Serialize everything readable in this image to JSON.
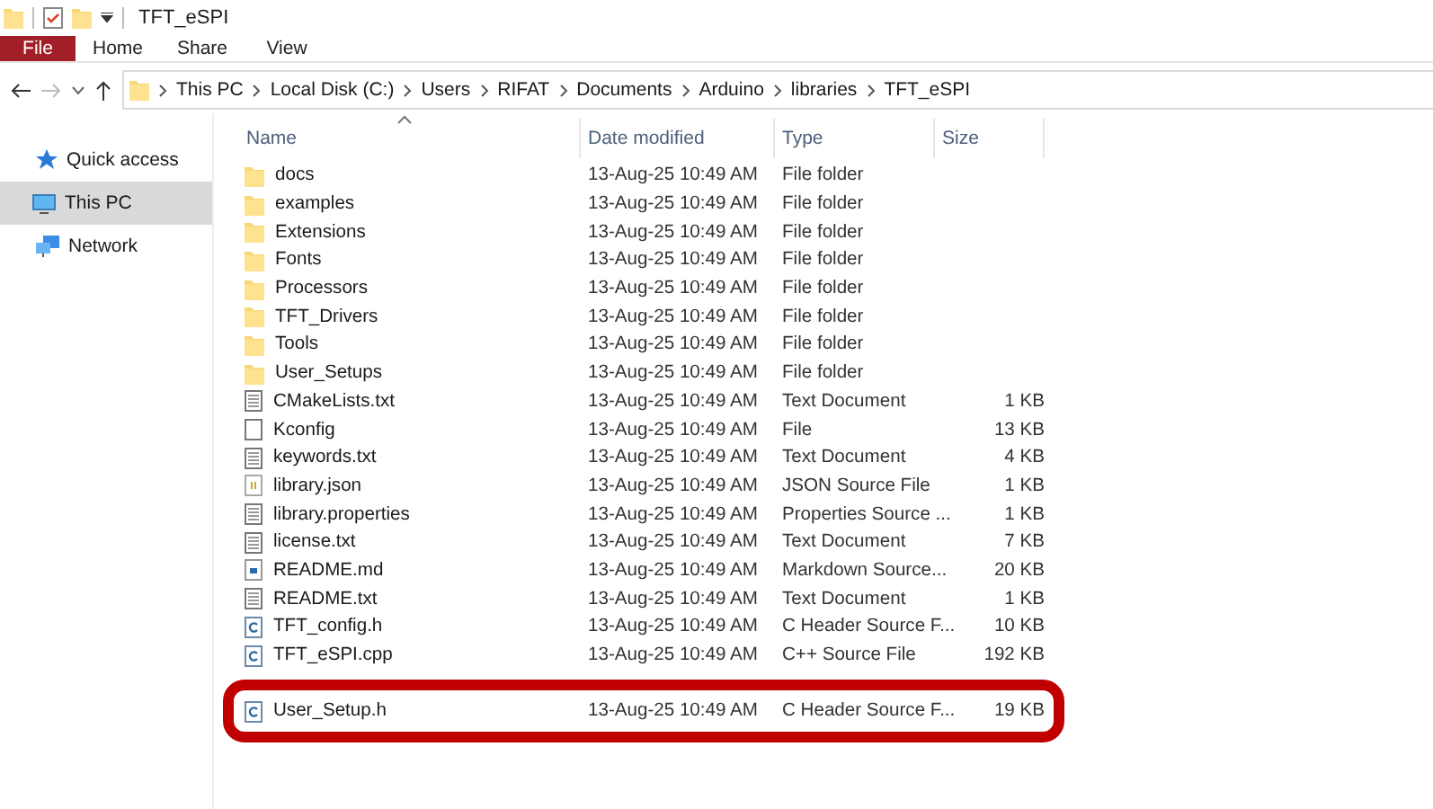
{
  "window": {
    "title": "TFT_eSPI"
  },
  "ribbon_tabs": [
    {
      "label": "File",
      "selected": true
    },
    {
      "label": "Home",
      "selected": false
    },
    {
      "label": "Share",
      "selected": false
    },
    {
      "label": "View",
      "selected": false
    }
  ],
  "navigation": {
    "forward_disabled": true
  },
  "address_bar": {
    "path": [
      "This PC",
      "Local Disk (C:)",
      "Users",
      "RIFAT",
      "Documents",
      "Arduino",
      "libraries",
      "TFT_eSPI"
    ]
  },
  "sidebar": {
    "items": [
      {
        "label": "Quick access",
        "kind": "star",
        "selected": false
      },
      {
        "label": "This PC",
        "kind": "computer",
        "selected": true
      },
      {
        "label": "Network",
        "kind": "network",
        "selected": false
      }
    ]
  },
  "table": {
    "columns": [
      "Name",
      "Date modified",
      "Type",
      "Size"
    ],
    "rows": [
      {
        "name": "docs",
        "date": "13-Aug-25 10:49 AM",
        "type": "File folder",
        "kind": "folder",
        "highlighted": false
      },
      {
        "name": "examples",
        "date": "13-Aug-25 10:49 AM",
        "type": "File folder",
        "kind": "folder",
        "highlighted": false
      },
      {
        "name": "Extensions",
        "date": "13-Aug-25 10:49 AM",
        "type": "File folder",
        "kind": "folder",
        "highlighted": false
      },
      {
        "name": "Fonts",
        "date": "13-Aug-25 10:49 AM",
        "type": "File folder",
        "kind": "folder",
        "highlighted": false
      },
      {
        "name": "Processors",
        "date": "13-Aug-25 10:49 AM",
        "type": "File folder",
        "kind": "folder",
        "highlighted": false
      },
      {
        "name": "TFT_Drivers",
        "date": "13-Aug-25 10:49 AM",
        "type": "File folder",
        "kind": "folder",
        "highlighted": false
      },
      {
        "name": "Tools",
        "date": "13-Aug-25 10:49 AM",
        "type": "File folder",
        "kind": "folder",
        "highlighted": false
      },
      {
        "name": "User_Setups",
        "date": "13-Aug-25 10:49 AM",
        "type": "File folder",
        "kind": "folder",
        "highlighted": false
      },
      {
        "name": "CMakeLists.txt",
        "date": "13-Aug-25 10:49 AM",
        "type": "Text Document",
        "size": "1 KB",
        "kind": "text",
        "highlighted": false
      },
      {
        "name": "Kconfig",
        "date": "13-Aug-25 10:49 AM",
        "type": "File",
        "size": "13 KB",
        "kind": "file",
        "highlighted": false
      },
      {
        "name": "keywords.txt",
        "date": "13-Aug-25 10:49 AM",
        "type": "Text Document",
        "size": "4 KB",
        "kind": "text",
        "highlighted": false
      },
      {
        "name": "library.json",
        "date": "13-Aug-25 10:49 AM",
        "type": "JSON Source File",
        "size": "1 KB",
        "kind": "json",
        "highlighted": false
      },
      {
        "name": "library.properties",
        "date": "13-Aug-25 10:49 AM",
        "type": "Properties Source ...",
        "size": "1 KB",
        "kind": "properties",
        "highlighted": false
      },
      {
        "name": "license.txt",
        "date": "13-Aug-25 10:49 AM",
        "type": "Text Document",
        "size": "7 KB",
        "kind": "text",
        "highlighted": false
      },
      {
        "name": "README.md",
        "date": "13-Aug-25 10:49 AM",
        "type": "Markdown Source...",
        "size": "20 KB",
        "kind": "markdown",
        "highlighted": false
      },
      {
        "name": "README.txt",
        "date": "13-Aug-25 10:49 AM",
        "type": "Text Document",
        "size": "1 KB",
        "kind": "text",
        "highlighted": false
      },
      {
        "name": "TFT_config.h",
        "date": "13-Aug-25 10:49 AM",
        "type": "C Header Source F...",
        "size": "10 KB",
        "kind": "c",
        "highlighted": false
      },
      {
        "name": "TFT_eSPI.cpp",
        "date": "13-Aug-25 10:49 AM",
        "type": "C++ Source File",
        "size": "192 KB",
        "kind": "cpp",
        "highlighted": false
      },
      {
        "name": "User_Setup.h",
        "date": "13-Aug-25 10:49 AM",
        "type": "C Header Source F...",
        "size": "19 KB",
        "kind": "c",
        "highlighted": true
      }
    ]
  }
}
